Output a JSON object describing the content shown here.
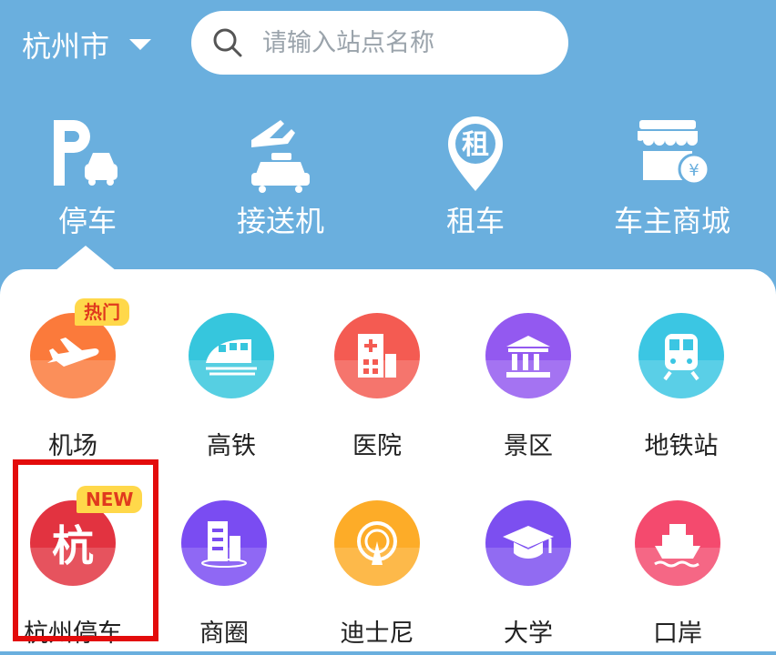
{
  "header": {
    "city": "杭州市",
    "search_placeholder": "请输入站点名称"
  },
  "top_nav": [
    {
      "label": "停车",
      "icon": "parking-icon"
    },
    {
      "label": "接送机",
      "icon": "airport-taxi-icon"
    },
    {
      "label": "租车",
      "icon": "rental-pin-icon",
      "glyph": "租"
    },
    {
      "label": "车主商城",
      "icon": "shop-icon"
    }
  ],
  "grid": [
    {
      "label": "机场",
      "icon": "airplane-icon",
      "color": "#fb7a3b",
      "badge": "热门"
    },
    {
      "label": "高铁",
      "icon": "train-icon",
      "color": "#36c6dd"
    },
    {
      "label": "医院",
      "icon": "hospital-icon",
      "color": "#f45b52"
    },
    {
      "label": "景区",
      "icon": "temple-icon",
      "color": "#9359f0"
    },
    {
      "label": "地铁站",
      "icon": "metro-icon",
      "color": "#3bc6e3"
    },
    {
      "label": "杭州停车",
      "icon": "hangzhou-logo-icon",
      "color": "#e23340",
      "badge": "NEW",
      "glyph": "杭"
    },
    {
      "label": "商圈",
      "icon": "building-icon",
      "color": "#7a4cf2"
    },
    {
      "label": "迪士尼",
      "icon": "castle-icon",
      "color": "#fdac28"
    },
    {
      "label": "大学",
      "icon": "graduation-cap-icon",
      "color": "#7c4ff0"
    },
    {
      "label": "口岸",
      "icon": "ship-icon",
      "color": "#f44a6e"
    }
  ]
}
